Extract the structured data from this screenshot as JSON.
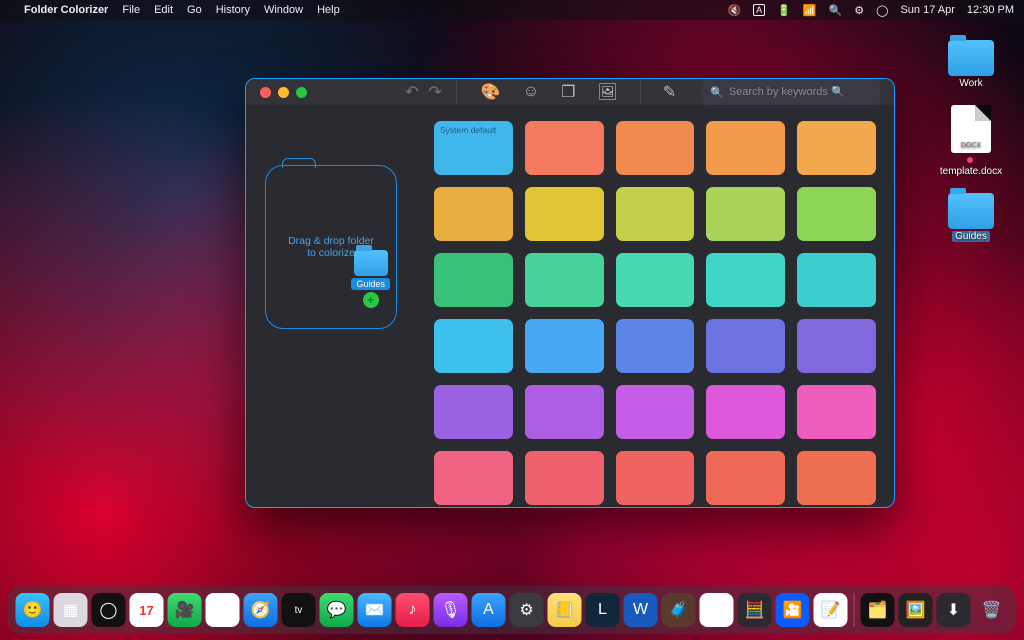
{
  "menubar": {
    "app": "Folder Colorizer",
    "items": [
      "File",
      "Edit",
      "Go",
      "History",
      "Window",
      "Help"
    ],
    "status_date": "Sun 17 Apr",
    "status_time": "12:30 PM",
    "input_source": "A"
  },
  "desktop": {
    "work_label": "Work",
    "doc_ext": "DOCX",
    "doc_label": "template.docx",
    "guides_label": "Guides"
  },
  "window": {
    "search_placeholder": "Search by keywords 🔍",
    "dropzone_line1": "Drag & drop folder",
    "dropzone_line2": "to colorize",
    "dragged_label": "Guides",
    "default_label": "System default",
    "colors": [
      "#3fb7ec",
      "#f37a5e",
      "#f08b4d",
      "#f19a4b",
      "#f4a84c",
      "#e9af3e",
      "#e0c535",
      "#c3cf46",
      "#a9d359",
      "#8dd557",
      "#38c277",
      "#45d399",
      "#48d8b2",
      "#3fd6c6",
      "#3ccecc",
      "#3dc1ec",
      "#48a9f2",
      "#5c84e9",
      "#6c72e0",
      "#8268de",
      "#9b63e1",
      "#b05fe5",
      "#c65de6",
      "#de58d9",
      "#ef5ebc",
      "#f06383",
      "#ef616d",
      "#ef6460",
      "#ee6a57",
      "#ee7050"
    ]
  },
  "dock": {
    "apps": [
      {
        "name": "finder",
        "bg": "linear-gradient(#3ac1ff,#0d8de6)",
        "glyph": "🙂"
      },
      {
        "name": "launchpad",
        "bg": "#d9d9df",
        "glyph": "▦"
      },
      {
        "name": "siri",
        "bg": "#111",
        "glyph": "◯"
      },
      {
        "name": "calendar",
        "bg": "#fff",
        "glyph": "17"
      },
      {
        "name": "facetime",
        "bg": "linear-gradient(#3ddc6f,#0fa84a)",
        "glyph": "🎥"
      },
      {
        "name": "chrome",
        "bg": "#fff",
        "glyph": "◎"
      },
      {
        "name": "safari",
        "bg": "linear-gradient(#3ea2ff,#0d6fe0)",
        "glyph": "🧭"
      },
      {
        "name": "appletv",
        "bg": "#111",
        "glyph": "tv"
      },
      {
        "name": "messages",
        "bg": "linear-gradient(#3ddc6f,#0fa84a)",
        "glyph": "💬"
      },
      {
        "name": "mail",
        "bg": "linear-gradient(#4ab8ff,#0d78e6)",
        "glyph": "✉️"
      },
      {
        "name": "music",
        "bg": "linear-gradient(#ff4d6b,#e61e4d)",
        "glyph": "♪"
      },
      {
        "name": "podcasts",
        "bg": "linear-gradient(#b85cff,#7a2de6)",
        "glyph": "🎙"
      },
      {
        "name": "appstore",
        "bg": "linear-gradient(#3ea2ff,#0d6fe0)",
        "glyph": "A"
      },
      {
        "name": "settings",
        "bg": "#3a3a3f",
        "glyph": "⚙"
      },
      {
        "name": "notes",
        "bg": "linear-gradient(#ffe27a,#f7c948)",
        "glyph": "📒"
      },
      {
        "name": "league",
        "bg": "#12263a",
        "glyph": "L"
      },
      {
        "name": "word",
        "bg": "#185abd",
        "glyph": "W"
      },
      {
        "name": "cot",
        "bg": "#5b3a2e",
        "glyph": "🧳"
      },
      {
        "name": "vlc",
        "bg": "#fff",
        "glyph": "▲"
      },
      {
        "name": "calc",
        "bg": "#2a2a30",
        "glyph": "🧮"
      },
      {
        "name": "zoom",
        "bg": "#0b5cff",
        "glyph": "🎦"
      },
      {
        "name": "textedit",
        "bg": "#fff",
        "glyph": "📝"
      }
    ],
    "right": [
      {
        "name": "folder-colorizer-dock",
        "bg": "#111",
        "glyph": "🗂️"
      },
      {
        "name": "screenshot-tool",
        "bg": "#222",
        "glyph": "🖼️"
      },
      {
        "name": "downloads",
        "bg": "#2a2a30",
        "glyph": "⬇"
      },
      {
        "name": "trash",
        "bg": "none",
        "glyph": "🗑️"
      }
    ]
  }
}
